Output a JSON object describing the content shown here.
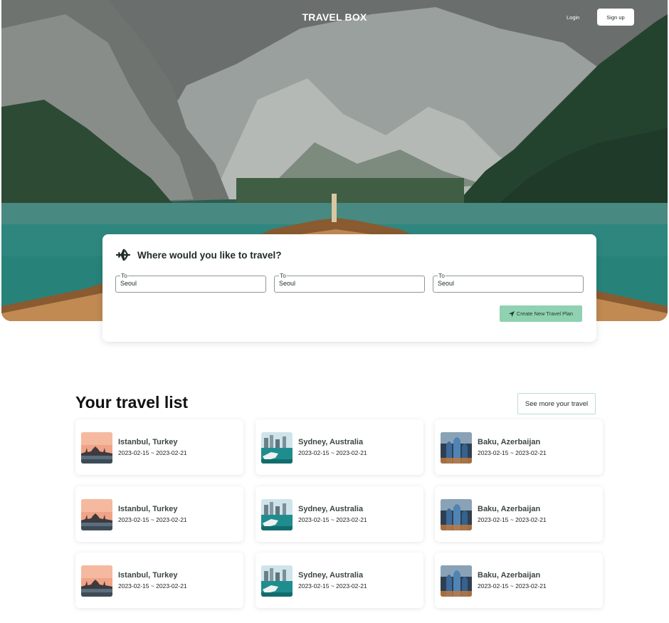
{
  "header": {
    "brand": "TRAVEL BOX",
    "login_label": "Login",
    "signup_label": "Sign up"
  },
  "planner": {
    "icon": "airplane-icon",
    "title": "Where would you like to travel?",
    "fields": [
      {
        "label": "To",
        "value": "Seoul"
      },
      {
        "label": "To",
        "value": "Seoul"
      },
      {
        "label": "To",
        "value": "Seoul"
      }
    ],
    "create_button_label": "Create New Travel Plan",
    "create_button_icon": "navigation-arrow-icon"
  },
  "travel_list": {
    "title": "Your travel list",
    "see_more_label": "See more your travel",
    "items": [
      {
        "city": "Istanbul, Turkey",
        "dates": "2023-02-15 ~ 2023-02-21",
        "thumb": "istanbul-photo"
      },
      {
        "city": "Sydney, Australia",
        "dates": "2023-02-15 ~ 2023-02-21",
        "thumb": "sydney-photo"
      },
      {
        "city": "Baku, Azerbaijan",
        "dates": "2023-02-15 ~ 2023-02-21",
        "thumb": "baku-photo"
      },
      {
        "city": "Istanbul, Turkey",
        "dates": "2023-02-15 ~ 2023-02-21",
        "thumb": "istanbul-photo"
      },
      {
        "city": "Sydney, Australia",
        "dates": "2023-02-15 ~ 2023-02-21",
        "thumb": "sydney-photo"
      },
      {
        "city": "Baku, Azerbaijan",
        "dates": "2023-02-15 ~ 2023-02-21",
        "thumb": "baku-photo"
      },
      {
        "city": "Istanbul, Turkey",
        "dates": "2023-02-15 ~ 2023-02-21",
        "thumb": "istanbul-photo"
      },
      {
        "city": "Sydney, Australia",
        "dates": "2023-02-15 ~ 2023-02-21",
        "thumb": "sydney-photo"
      },
      {
        "city": "Baku, Azerbaijan",
        "dates": "2023-02-15 ~ 2023-02-21",
        "thumb": "baku-photo"
      }
    ]
  },
  "colors": {
    "accent": "#8fd1b0",
    "accent_border": "#b9dfcf",
    "lake": "#2f8c84",
    "forest": "#24432f"
  }
}
